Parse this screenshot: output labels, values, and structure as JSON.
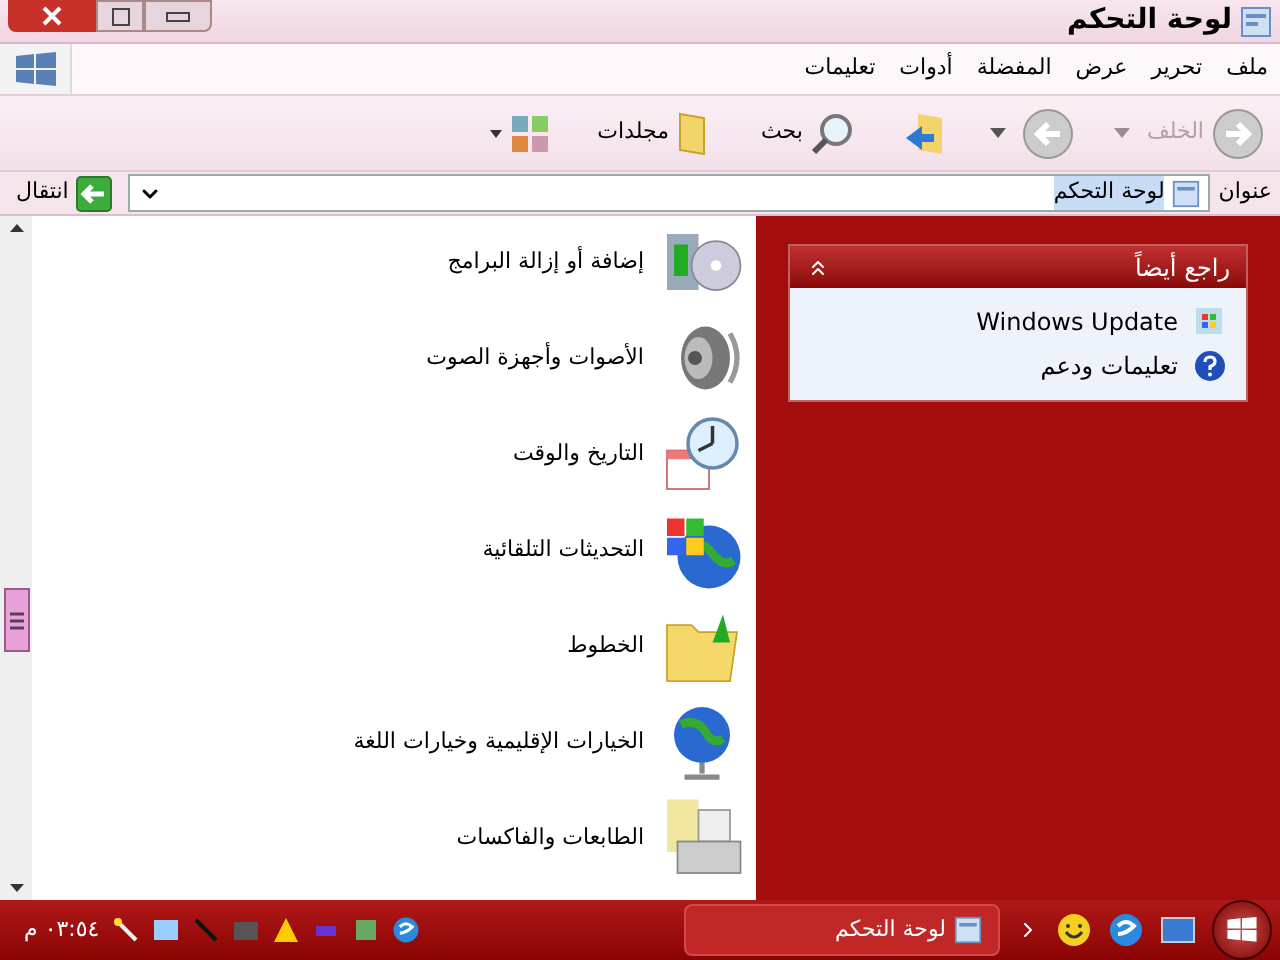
{
  "window": {
    "title": "لوحة التحكم"
  },
  "menu": [
    "ملف",
    "تحرير",
    "عرض",
    "المفضلة",
    "أدوات",
    "تعليمات"
  ],
  "toolbar": {
    "back": {
      "label": "الخلف",
      "disabled": true
    },
    "search": "بحث",
    "folders": "مجلدات"
  },
  "address": {
    "label": "عنوان",
    "value": "لوحة التحكم",
    "go": "انتقال"
  },
  "items": [
    {
      "label": "إضافة أو إزالة البرامج",
      "kind": "programs"
    },
    {
      "label": "الأصوات وأجهزة الصوت",
      "kind": "sound"
    },
    {
      "label": "التاريخ والوقت",
      "kind": "clock"
    },
    {
      "label": "التحديثات التلقائية",
      "kind": "update"
    },
    {
      "label": "الخطوط",
      "kind": "fonts"
    },
    {
      "label": "الخيارات الإقليمية وخيارات اللغة",
      "kind": "globe"
    },
    {
      "label": "الطابعات والفاكسات",
      "kind": "printer"
    }
  ],
  "see_also": {
    "title": "راجع أيضاً",
    "expanded": true,
    "links": [
      {
        "label": "Windows Update",
        "kind": "update"
      },
      {
        "label": "تعليمات ودعم",
        "kind": "help"
      }
    ]
  },
  "taskbar": {
    "tasks": [
      {
        "label": "لوحة التحكم",
        "selected": true
      }
    ],
    "clock": "٠٣:٥٤ م"
  }
}
